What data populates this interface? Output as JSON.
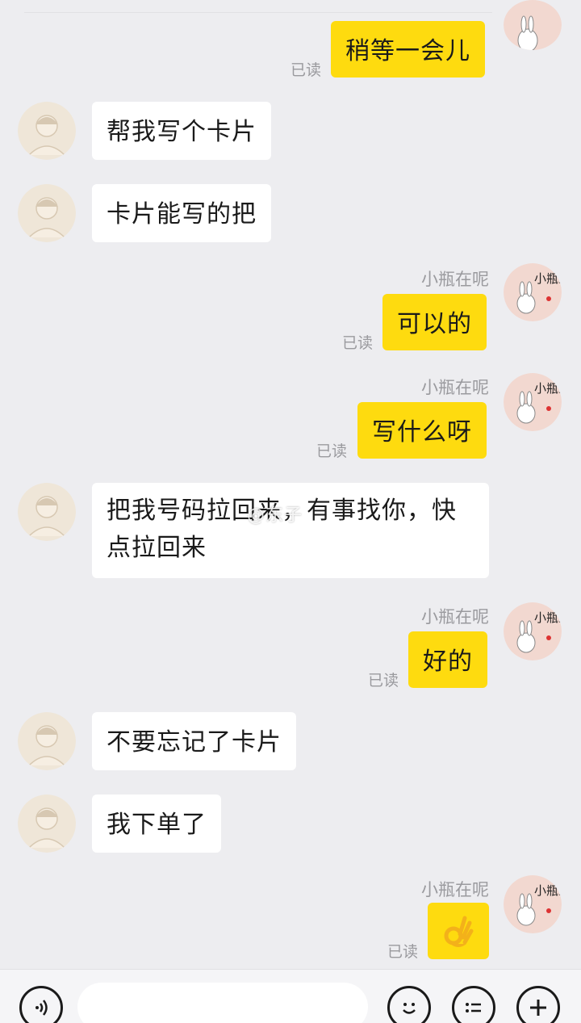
{
  "messages": [
    {
      "from": "me",
      "text": "稍等一会儿",
      "read": "已读"
    },
    {
      "from": "them",
      "text": "帮我写个卡片"
    },
    {
      "from": "them",
      "text": "卡片能写的把"
    },
    {
      "from": "me",
      "sender": "小瓶在呢",
      "text": "可以的",
      "read": "已读"
    },
    {
      "from": "me",
      "sender": "小瓶在呢",
      "text": "写什么呀",
      "read": "已读"
    },
    {
      "from": "them",
      "text": "把我号码拉回来，有事找你，快点拉回来"
    },
    {
      "from": "me",
      "sender": "小瓶在呢",
      "text": "好的",
      "read": "已读"
    },
    {
      "from": "them",
      "text": "不要忘记了卡片"
    },
    {
      "from": "them",
      "text": "我下单了"
    },
    {
      "from": "me",
      "sender": "小瓶在呢",
      "emoji": "ok-hand",
      "read": "已读"
    }
  ],
  "watermark": "@东子",
  "avatar_text": {
    "me": "小瓶家"
  },
  "toolbar": {
    "voice_icon": "voice-icon",
    "emoji_icon": "smiley-icon",
    "menu_icon": "list-menu-icon",
    "add_icon": "plus-icon"
  },
  "colors": {
    "background": "#ededf0",
    "outgoing_bubble": "#fedb0f",
    "incoming_bubble": "#ffffff",
    "muted_text": "#9a9a9e"
  }
}
